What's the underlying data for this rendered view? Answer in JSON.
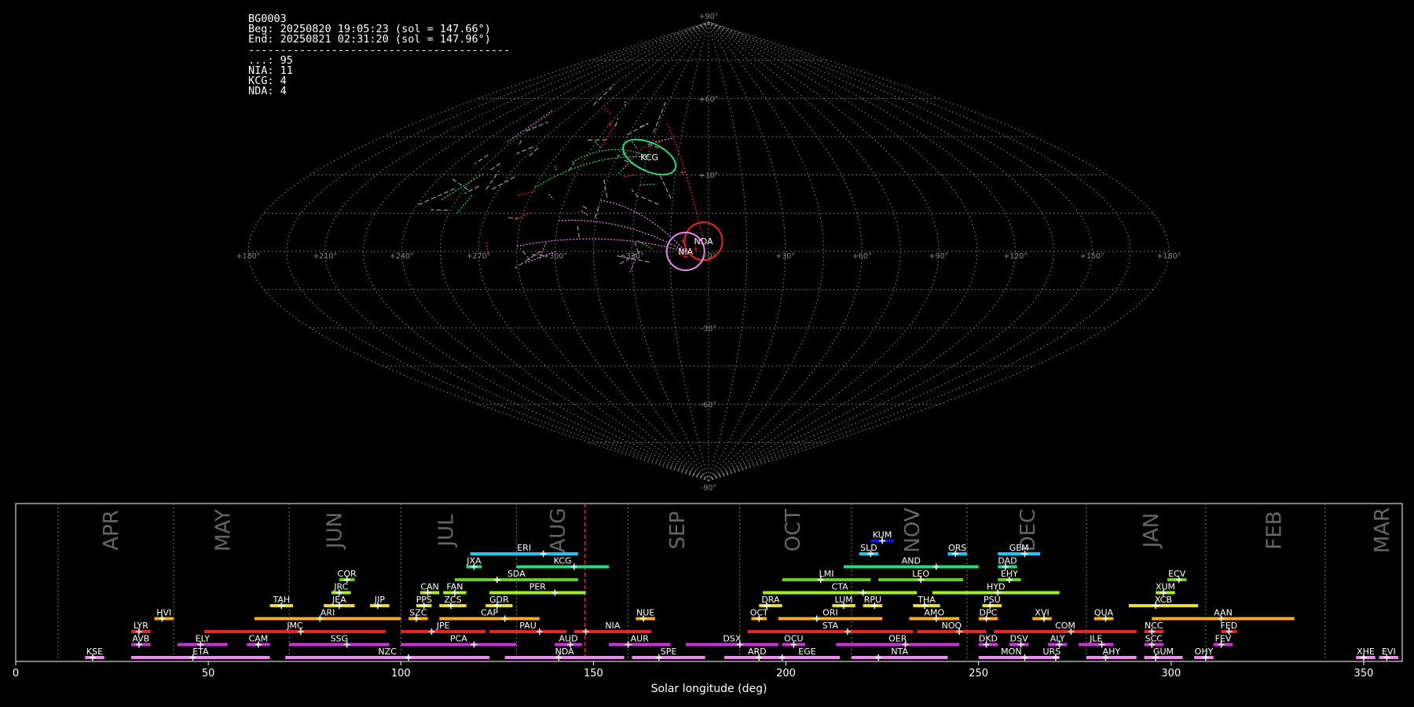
{
  "stats": {
    "id": "BG0003",
    "beg": "Beg: 20250820 19:05:23 (sol = 147.66°)",
    "end": "End: 20250821 02:31:20 (sol = 147.96°)",
    "rule": "-----------------------------------------",
    "counts": [
      {
        "label": "...",
        "value": 95
      },
      {
        "label": "NIA",
        "value": 11
      },
      {
        "label": "KCG",
        "value": 4
      },
      {
        "label": "NDA",
        "value": 4
      }
    ]
  },
  "chart_data": [
    {
      "type": "scatter",
      "projection": "sinusoidal",
      "grid": true,
      "lon_tick_labels": [
        "+180°",
        "+150°",
        "+120°",
        "+90°",
        "+60°",
        "+30°",
        "+0°",
        "+330°",
        "+300°",
        "+270°",
        "+240°",
        "+210°",
        "+180°"
      ],
      "lat_tick_labels": [
        "+90°",
        "+60°",
        "+30°",
        "-30°",
        "-60°",
        "-90°"
      ],
      "lat_tick_values": [
        90,
        60,
        30,
        -30,
        -60,
        -90
      ],
      "radiants": [
        {
          "name": "KCG",
          "x": -29,
          "y": 37,
          "color": "#22dd77"
        },
        {
          "name": "NDA",
          "x": -2,
          "y": 4,
          "color": "#ee2222"
        },
        {
          "name": "NIA",
          "x": -9,
          "y": 0,
          "color": "#ee88ee"
        }
      ],
      "stray_radiants": [
        {
          "x": -12,
          "y": 31
        },
        {
          "x": -10,
          "y": 4
        },
        {
          "x": -9,
          "y": -2
        },
        {
          "x": -11,
          "y": -1
        },
        {
          "x": -5,
          "y": 1
        },
        {
          "x": -60,
          "y": 50
        }
      ]
    },
    {
      "type": "timeline",
      "xlabel": "Solar longitude (deg)",
      "xlim": [
        0,
        360
      ],
      "xticks": [
        0,
        50,
        100,
        150,
        200,
        250,
        300,
        350
      ],
      "current_sol": 147.8,
      "month_boundaries": [
        11,
        41,
        71,
        100,
        130,
        159,
        188,
        217,
        247,
        278,
        309,
        340
      ],
      "months": [
        {
          "name": "APR",
          "x": 25
        },
        {
          "name": "MAY",
          "x": 54
        },
        {
          "name": "JUN",
          "x": 83
        },
        {
          "name": "JUL",
          "x": 112
        },
        {
          "name": "AUG",
          "x": 141
        },
        {
          "name": "SEP",
          "x": 172
        },
        {
          "name": "OCT",
          "x": 202
        },
        {
          "name": "NOV",
          "x": 233
        },
        {
          "name": "DEC",
          "x": 263
        },
        {
          "name": "JAN",
          "x": 295
        },
        {
          "name": "FEB",
          "x": 327
        },
        {
          "name": "MAR",
          "x": 355
        }
      ],
      "showers": [
        {
          "code": "KUM",
          "start": 222,
          "end": 228,
          "peak": 225,
          "row": 10,
          "color": "#1111ee"
        },
        {
          "code": "ERI",
          "start": 118,
          "end": 146,
          "peak": 137,
          "row": 9,
          "color": "#11ccee"
        },
        {
          "code": "SLD",
          "start": 219,
          "end": 224,
          "peak": 222,
          "row": 9,
          "color": "#11ccee"
        },
        {
          "code": "ORS",
          "start": 242,
          "end": 247,
          "peak": 244,
          "row": 9,
          "color": "#11ccee"
        },
        {
          "code": "GEM",
          "start": 255,
          "end": 266,
          "peak": 262,
          "row": 9,
          "color": "#11ccee"
        },
        {
          "code": "JXA",
          "start": 117,
          "end": 121,
          "peak": 119,
          "row": 8,
          "color": "#22dd77"
        },
        {
          "code": "KCG",
          "start": 130,
          "end": 154,
          "peak": 145,
          "row": 8,
          "color": "#22dd77"
        },
        {
          "code": "AND",
          "start": 215,
          "end": 250,
          "peak": 239,
          "row": 8,
          "color": "#22dd77"
        },
        {
          "code": "DAD",
          "start": 255,
          "end": 260,
          "peak": 257,
          "row": 8,
          "color": "#22dd77"
        },
        {
          "code": "COR",
          "start": 84,
          "end": 88,
          "peak": 86,
          "row": 7,
          "color": "#66cc22"
        },
        {
          "code": "SDA",
          "start": 114,
          "end": 146,
          "peak": 125,
          "row": 7,
          "color": "#66cc22"
        },
        {
          "code": "LMI",
          "start": 199,
          "end": 222,
          "peak": 209,
          "row": 7,
          "color": "#66cc22"
        },
        {
          "code": "LEO",
          "start": 224,
          "end": 246,
          "peak": 235,
          "row": 7,
          "color": "#66cc22"
        },
        {
          "code": "EHY",
          "start": 255,
          "end": 261,
          "peak": 258,
          "row": 7,
          "color": "#66cc22"
        },
        {
          "code": "ECV",
          "start": 299,
          "end": 304,
          "peak": 302,
          "row": 7,
          "color": "#66cc22"
        },
        {
          "code": "JRC",
          "start": 82,
          "end": 87,
          "peak": 84,
          "row": 6,
          "color": "#aaee22"
        },
        {
          "code": "CAN",
          "start": 105,
          "end": 110,
          "peak": 107,
          "row": 6,
          "color": "#aaee22"
        },
        {
          "code": "FAN",
          "start": 111,
          "end": 117,
          "peak": 114,
          "row": 6,
          "color": "#aaee22"
        },
        {
          "code": "PER",
          "start": 123,
          "end": 148,
          "peak": 140,
          "row": 6,
          "color": "#aaee22"
        },
        {
          "code": "CTA",
          "start": 194,
          "end": 234,
          "peak": 220,
          "row": 6,
          "color": "#aaee22"
        },
        {
          "code": "HYD",
          "start": 238,
          "end": 271,
          "peak": 255,
          "row": 6,
          "color": "#aaee22"
        },
        {
          "code": "XUM",
          "start": 296,
          "end": 301,
          "peak": 298,
          "row": 6,
          "color": "#aaee22"
        },
        {
          "code": "TAH",
          "start": 66,
          "end": 72,
          "peak": 69,
          "row": 5,
          "color": "#eedd22"
        },
        {
          "code": "JEA",
          "start": 80,
          "end": 88,
          "peak": 84,
          "row": 5,
          "color": "#eedd22"
        },
        {
          "code": "JIP",
          "start": 92,
          "end": 97,
          "peak": 94,
          "row": 5,
          "color": "#eedd22"
        },
        {
          "code": "PPS",
          "start": 104,
          "end": 108,
          "peak": 106,
          "row": 5,
          "color": "#eedd22"
        },
        {
          "code": "ZCS",
          "start": 110,
          "end": 117,
          "peak": 113,
          "row": 5,
          "color": "#eedd22"
        },
        {
          "code": "GDR",
          "start": 122,
          "end": 129,
          "peak": 125,
          "row": 5,
          "color": "#eedd22"
        },
        {
          "code": "DRA",
          "start": 193,
          "end": 199,
          "peak": 195,
          "row": 5,
          "color": "#eedd22"
        },
        {
          "code": "LUM",
          "start": 212,
          "end": 218,
          "peak": 215,
          "row": 5,
          "color": "#eedd22"
        },
        {
          "code": "RPU",
          "start": 220,
          "end": 225,
          "peak": 223,
          "row": 5,
          "color": "#eedd22"
        },
        {
          "code": "THA",
          "start": 233,
          "end": 240,
          "peak": 236,
          "row": 5,
          "color": "#eedd22"
        },
        {
          "code": "PSU",
          "start": 251,
          "end": 256,
          "peak": 253,
          "row": 5,
          "color": "#eedd22"
        },
        {
          "code": "XCB",
          "start": 289,
          "end": 307,
          "peak": 296,
          "row": 5,
          "color": "#eedd22"
        },
        {
          "code": "HVI",
          "start": 36,
          "end": 41,
          "peak": 38,
          "row": 4,
          "color": "#ffaa22"
        },
        {
          "code": "ARI",
          "start": 62,
          "end": 100,
          "peak": 79,
          "row": 4,
          "color": "#ffaa22"
        },
        {
          "code": "SZC",
          "start": 102,
          "end": 107,
          "peak": 104,
          "row": 4,
          "color": "#ffaa22"
        },
        {
          "code": "CAP",
          "start": 110,
          "end": 136,
          "peak": 127,
          "row": 4,
          "color": "#ffaa22"
        },
        {
          "code": "NUE",
          "start": 161,
          "end": 166,
          "peak": 163,
          "row": 4,
          "color": "#ffaa22"
        },
        {
          "code": "OCT",
          "start": 191,
          "end": 195,
          "peak": 193,
          "row": 4,
          "color": "#ffaa22"
        },
        {
          "code": "ORI",
          "start": 198,
          "end": 225,
          "peak": 208,
          "row": 4,
          "color": "#ffaa22"
        },
        {
          "code": "AMO",
          "start": 232,
          "end": 245,
          "peak": 239,
          "row": 4,
          "color": "#ffaa22"
        },
        {
          "code": "DPC",
          "start": 250,
          "end": 255,
          "peak": 252,
          "row": 4,
          "color": "#ffaa22"
        },
        {
          "code": "XVI",
          "start": 264,
          "end": 269,
          "peak": 267,
          "row": 4,
          "color": "#ffaa22"
        },
        {
          "code": "QUA",
          "start": 280,
          "end": 285,
          "peak": 283,
          "row": 4,
          "color": "#ffaa22"
        },
        {
          "code": "AAN",
          "start": 295,
          "end": 332,
          "peak": 313,
          "row": 4,
          "color": "#ffaa22"
        },
        {
          "code": "LYR",
          "start": 30,
          "end": 35,
          "peak": 32,
          "row": 3,
          "color": "#ee2222"
        },
        {
          "code": "JMC",
          "start": 49,
          "end": 96,
          "peak": 74,
          "row": 3,
          "color": "#ee2222"
        },
        {
          "code": "JPE",
          "start": 100,
          "end": 122,
          "peak": 108,
          "row": 3,
          "color": "#ee2222"
        },
        {
          "code": "PAU",
          "start": 123,
          "end": 143,
          "peak": 136,
          "row": 3,
          "color": "#ee2222"
        },
        {
          "code": "NIA",
          "start": 145,
          "end": 165,
          "peak": 148,
          "row": 3,
          "color": "#ee2222"
        },
        {
          "code": "STA",
          "start": 190,
          "end": 233,
          "peak": 216,
          "row": 3,
          "color": "#ee2222"
        },
        {
          "code": "NOO",
          "start": 234,
          "end": 252,
          "peak": 245,
          "row": 3,
          "color": "#ee2222"
        },
        {
          "code": "COM",
          "start": 254,
          "end": 291,
          "peak": 274,
          "row": 3,
          "color": "#ee2222"
        },
        {
          "code": "NCC",
          "start": 293,
          "end": 298,
          "peak": 295,
          "row": 3,
          "color": "#ee2222"
        },
        {
          "code": "FED",
          "start": 313,
          "end": 317,
          "peak": 315,
          "row": 3,
          "color": "#ee2222"
        },
        {
          "code": "AVB",
          "start": 30,
          "end": 35,
          "peak": 32,
          "row": 2,
          "color": "#cc33dd"
        },
        {
          "code": "ELY",
          "start": 42,
          "end": 55,
          "peak": 48,
          "row": 2,
          "color": "#cc33dd"
        },
        {
          "code": "CAM",
          "start": 60,
          "end": 66,
          "peak": 63,
          "row": 2,
          "color": "#cc33dd"
        },
        {
          "code": "SSG",
          "start": 71,
          "end": 97,
          "peak": 86,
          "row": 2,
          "color": "#cc33dd"
        },
        {
          "code": "PCA",
          "start": 100,
          "end": 130,
          "peak": 119,
          "row": 2,
          "color": "#cc33dd"
        },
        {
          "code": "AUD",
          "start": 140,
          "end": 147,
          "peak": 144,
          "row": 2,
          "color": "#cc33dd"
        },
        {
          "code": "AUR",
          "start": 154,
          "end": 170,
          "peak": 159,
          "row": 2,
          "color": "#cc33dd"
        },
        {
          "code": "DSX",
          "start": 174,
          "end": 198,
          "peak": 188,
          "row": 2,
          "color": "#cc33dd"
        },
        {
          "code": "OCU",
          "start": 199,
          "end": 205,
          "peak": 202,
          "row": 2,
          "color": "#cc33dd"
        },
        {
          "code": "OER",
          "start": 213,
          "end": 245,
          "peak": 231,
          "row": 2,
          "color": "#cc33dd"
        },
        {
          "code": "DKD",
          "start": 250,
          "end": 255,
          "peak": 252,
          "row": 2,
          "color": "#cc33dd"
        },
        {
          "code": "DSV",
          "start": 258,
          "end": 263,
          "peak": 261,
          "row": 2,
          "color": "#cc33dd"
        },
        {
          "code": "ALY",
          "start": 268,
          "end": 273,
          "peak": 271,
          "row": 2,
          "color": "#cc33dd"
        },
        {
          "code": "JLE",
          "start": 276,
          "end": 285,
          "peak": 282,
          "row": 2,
          "color": "#cc33dd"
        },
        {
          "code": "SCC",
          "start": 293,
          "end": 298,
          "peak": 295,
          "row": 2,
          "color": "#cc33dd"
        },
        {
          "code": "FEV",
          "start": 311,
          "end": 316,
          "peak": 313,
          "row": 2,
          "color": "#cc33dd"
        },
        {
          "code": "KSE",
          "start": 18,
          "end": 23,
          "peak": 20,
          "row": 1,
          "color": "#ee88ee"
        },
        {
          "code": "ETA",
          "start": 30,
          "end": 66,
          "peak": 46,
          "row": 1,
          "color": "#ee88ee"
        },
        {
          "code": "NZC",
          "start": 70,
          "end": 123,
          "peak": 102,
          "row": 1,
          "color": "#ee88ee"
        },
        {
          "code": "NDA",
          "start": 127,
          "end": 158,
          "peak": 141,
          "row": 1,
          "color": "#ee88ee"
        },
        {
          "code": "SPE",
          "start": 160,
          "end": 179,
          "peak": 167,
          "row": 1,
          "color": "#ee88ee"
        },
        {
          "code": "ARD",
          "start": 184,
          "end": 201,
          "peak": 193,
          "row": 1,
          "color": "#ee88ee"
        },
        {
          "code": "EGE",
          "start": 197,
          "end": 214,
          "peak": 199,
          "row": 1,
          "color": "#ee88ee"
        },
        {
          "code": "NTA",
          "start": 217,
          "end": 242,
          "peak": 224,
          "row": 1,
          "color": "#ee88ee"
        },
        {
          "code": "MON",
          "start": 250,
          "end": 267,
          "peak": 262,
          "row": 1,
          "color": "#ee88ee"
        },
        {
          "code": "URS",
          "start": 267,
          "end": 271,
          "peak": 270,
          "row": 1,
          "color": "#ee88ee"
        },
        {
          "code": "AHY",
          "start": 278,
          "end": 291,
          "peak": 283,
          "row": 1,
          "color": "#ee88ee"
        },
        {
          "code": "GUM",
          "start": 293,
          "end": 303,
          "peak": 296,
          "row": 1,
          "color": "#ee88ee"
        },
        {
          "code": "OHY",
          "start": 306,
          "end": 311,
          "peak": 309,
          "row": 1,
          "color": "#ee88ee"
        },
        {
          "code": "XHE",
          "start": 348,
          "end": 353,
          "peak": 350,
          "row": 1,
          "color": "#ee88ee"
        },
        {
          "code": "EVI",
          "start": 354,
          "end": 359,
          "peak": 356,
          "row": 1,
          "color": "#ee88ee"
        }
      ]
    }
  ]
}
